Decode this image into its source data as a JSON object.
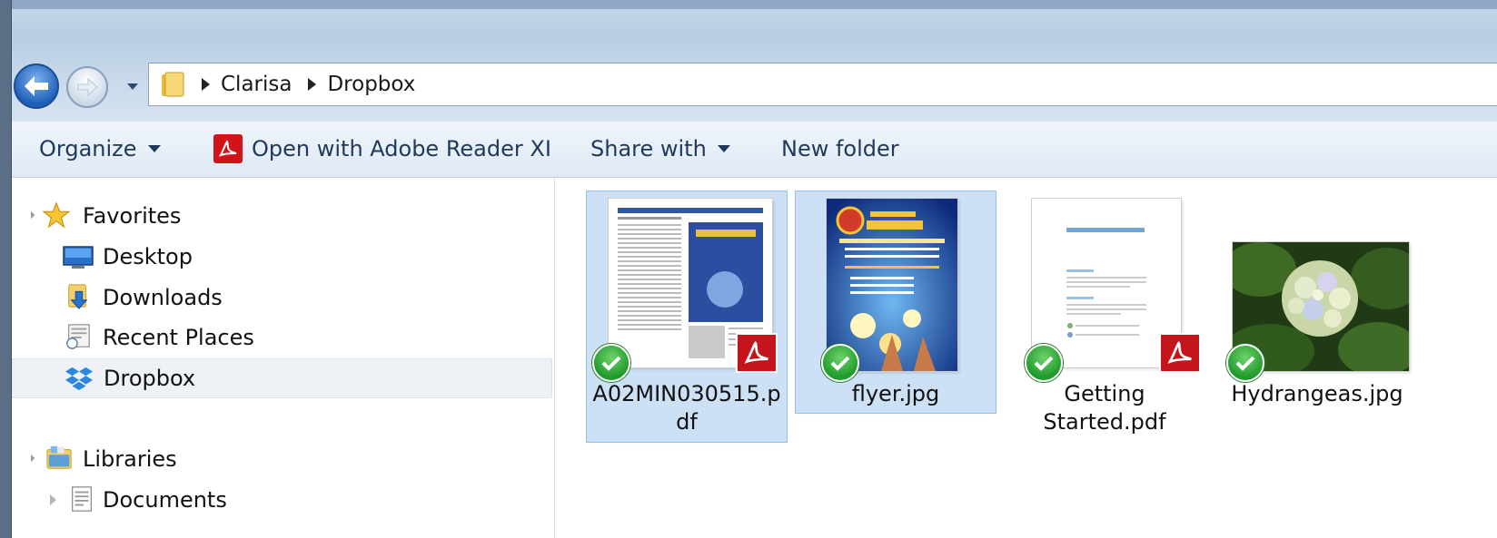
{
  "breadcrumb": {
    "items": [
      "Clarisa",
      "Dropbox"
    ]
  },
  "toolbar": {
    "organize": "Organize",
    "open_with": "Open with Adobe Reader XI",
    "share_with": "Share with",
    "new_folder": "New folder"
  },
  "navpane": {
    "favorites_label": "Favorites",
    "desktop_label": "Desktop",
    "downloads_label": "Downloads",
    "recent_label": "Recent Places",
    "dropbox_label": "Dropbox",
    "libraries_label": "Libraries",
    "documents_label": "Documents"
  },
  "files": [
    {
      "name_line1": "A02MIN030515.p",
      "name_line2": "df",
      "type": "pdf",
      "selected": true,
      "synced": true
    },
    {
      "name_line1": "flyer.jpg",
      "name_line2": "",
      "type": "jpg",
      "selected": true,
      "synced": true
    },
    {
      "name_line1": "Getting",
      "name_line2": "Started.pdf",
      "type": "pdf",
      "selected": false,
      "synced": true
    },
    {
      "name_line1": "Hydrangeas.jpg",
      "name_line2": "",
      "type": "jpg",
      "selected": false,
      "synced": true
    }
  ],
  "icons": {
    "back": "back-arrow-icon",
    "forward": "forward-arrow-icon",
    "folder": "folder-icon",
    "pdf": "adobe-pdf-icon",
    "sync": "sync-check-icon"
  },
  "colors": {
    "selection_bg": "#cce1f6",
    "toolbar_text": "#1e395b",
    "sync_green": "#1f9a2b",
    "pdf_red": "#c3151b"
  }
}
